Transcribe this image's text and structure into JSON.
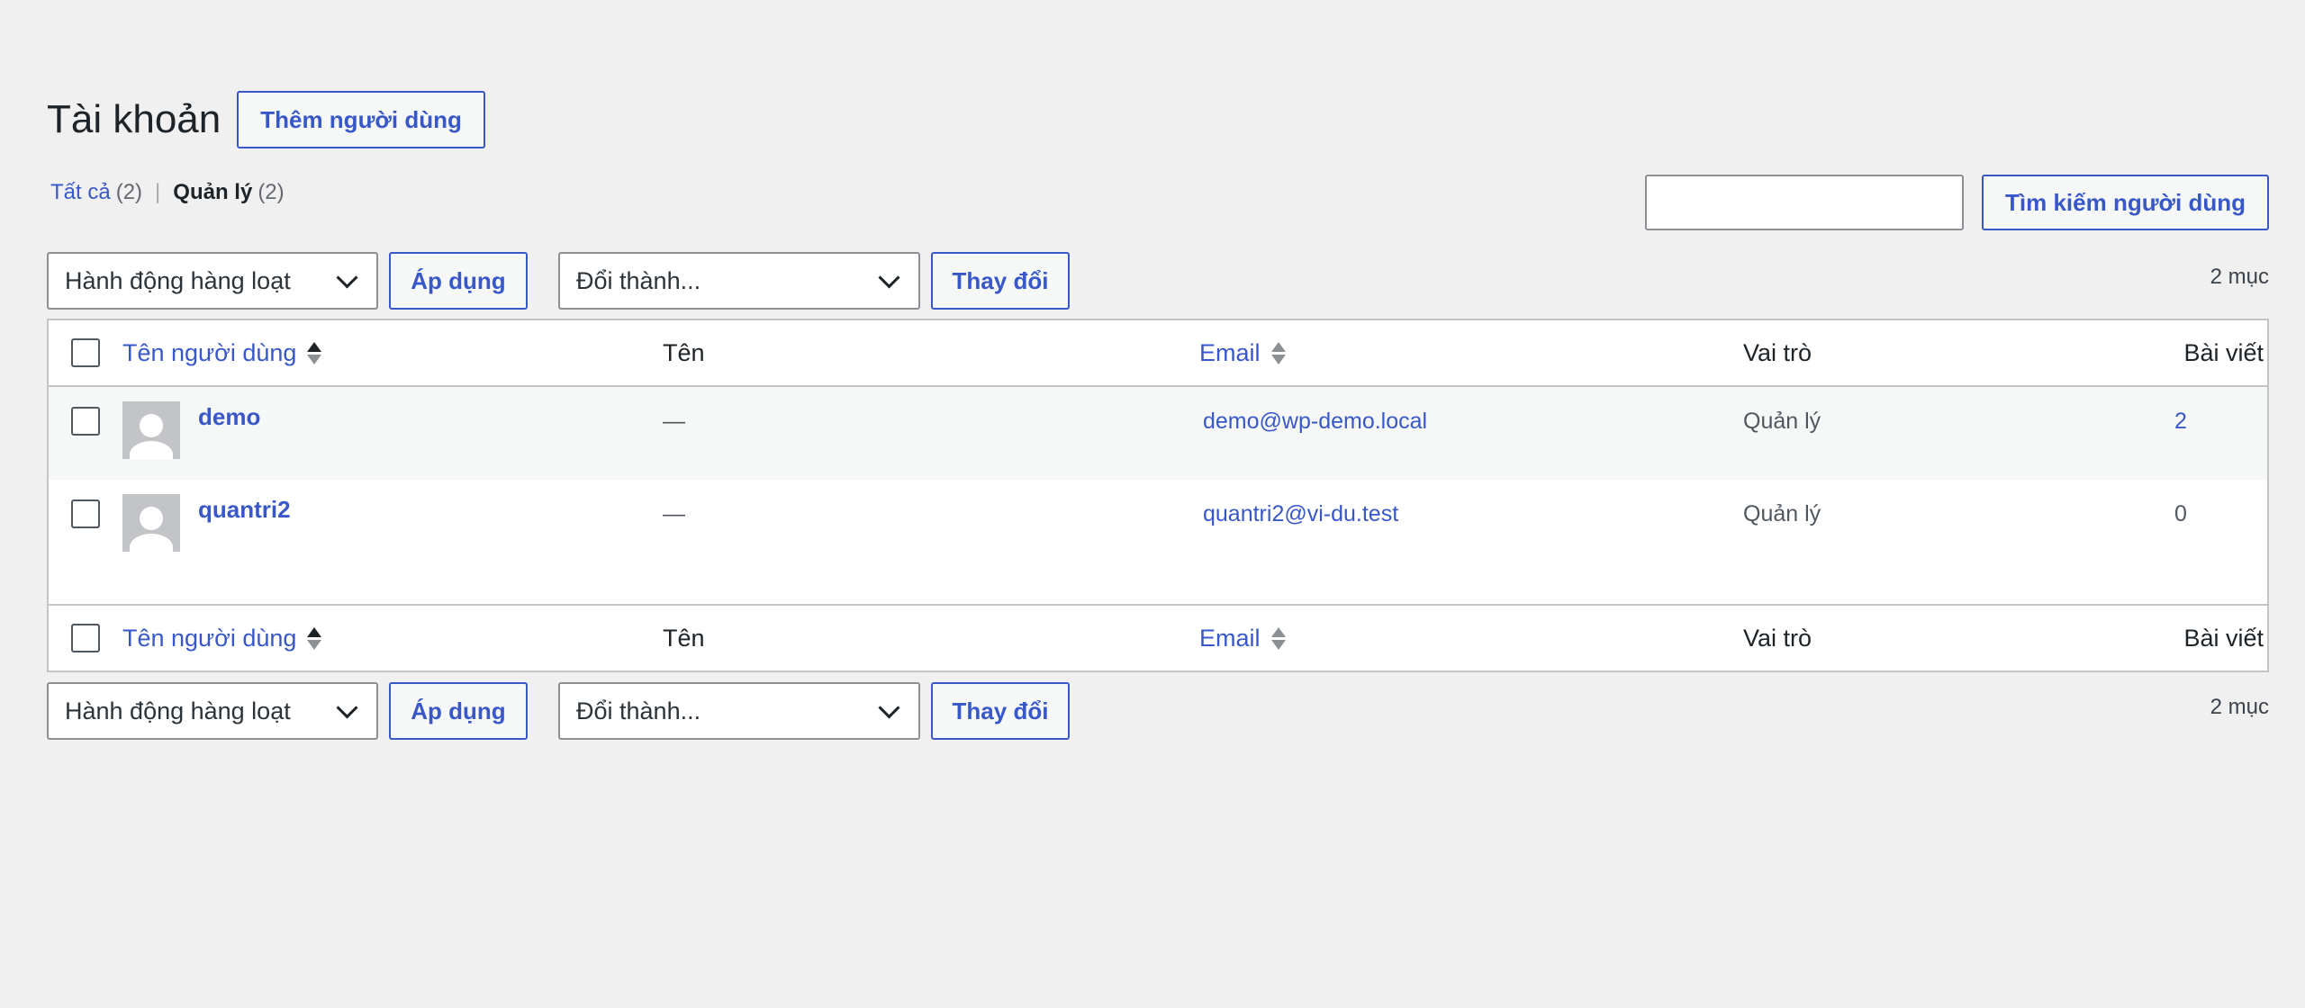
{
  "page": {
    "title": "Tài khoản",
    "add_user_label": "Thêm người dùng"
  },
  "filters": {
    "all_label": "Tất cả",
    "all_count": "(2)",
    "separator": "|",
    "admin_label": "Quản lý",
    "admin_count": "(2)"
  },
  "search": {
    "value": "",
    "button_label": "Tìm kiếm người dùng"
  },
  "tablenav": {
    "bulk_action_selected": "Hành động hàng loạt",
    "apply_label": "Áp dụng",
    "change_role_selected": "Đổi thành...",
    "change_label": "Thay đổi",
    "items_count": "2 mục"
  },
  "table": {
    "columns": {
      "username": "Tên người dùng",
      "name": "Tên",
      "email": "Email",
      "role": "Vai trò",
      "posts": "Bài viết"
    },
    "rows": [
      {
        "username": "demo",
        "name": "—",
        "email": "demo@wp-demo.local",
        "role": "Quản lý",
        "posts": "2"
      },
      {
        "username": "quantri2",
        "name": "—",
        "email": "quantri2@vi-du.test",
        "role": "Quản lý",
        "posts": "0"
      }
    ]
  },
  "icons": {
    "sort": "sort-arrows-icon",
    "dropdown": "chevron-down-icon",
    "avatar": "default-avatar-icon"
  },
  "colors": {
    "link": "#3858c9",
    "background": "#f0f0f1",
    "alt_row": "#f6f7f7",
    "border": "#c3c4c7"
  }
}
